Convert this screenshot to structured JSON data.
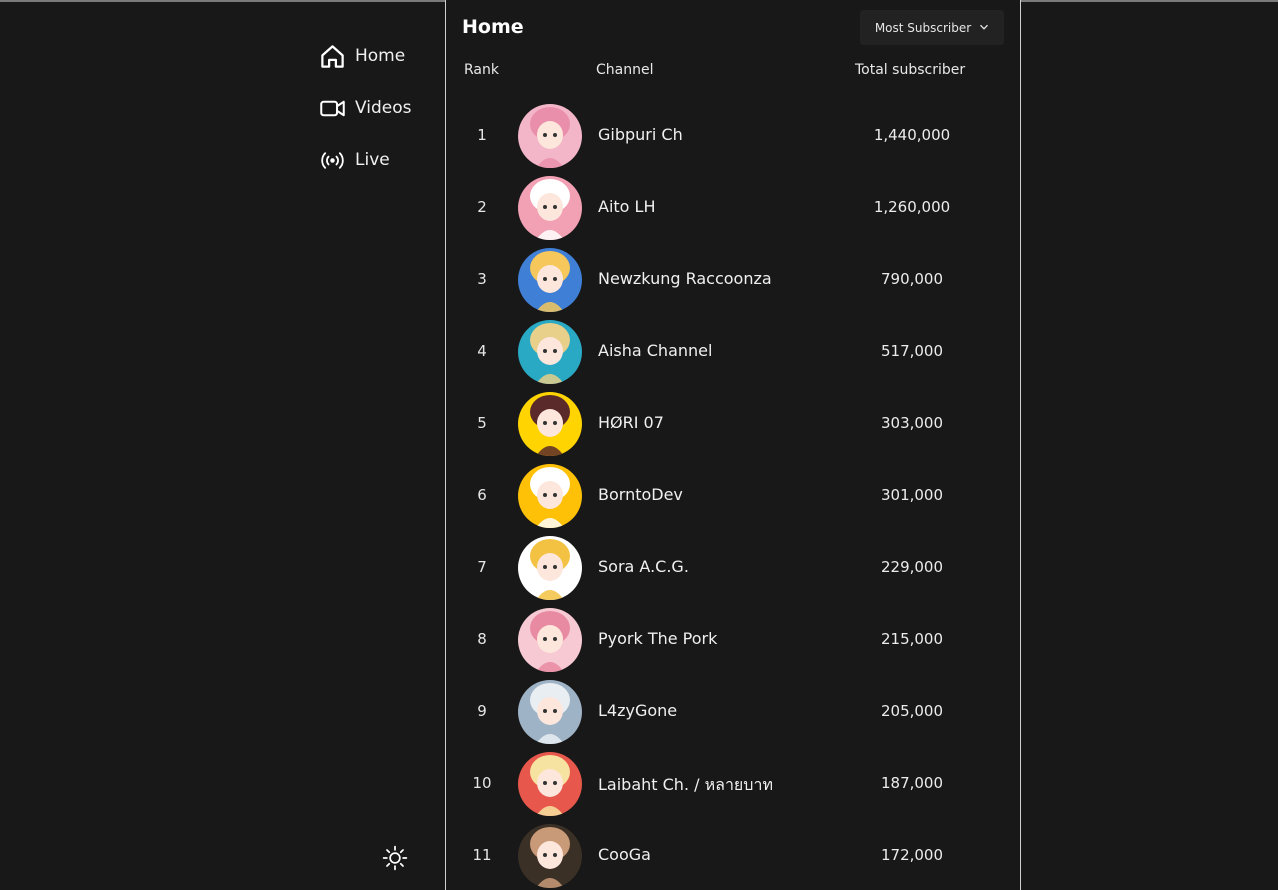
{
  "sidebar": {
    "items": [
      {
        "label": "Home",
        "icon": "home-icon"
      },
      {
        "label": "Videos",
        "icon": "video-icon"
      },
      {
        "label": "Live",
        "icon": "live-icon"
      }
    ],
    "theme_icon": "sun-icon"
  },
  "header": {
    "title": "Home",
    "sort_label": "Most Subscriber",
    "sort_icon": "chevron-down-icon"
  },
  "table": {
    "columns": {
      "rank": "Rank",
      "channel": "Channel",
      "subscribers": "Total subscriber"
    },
    "rows": [
      {
        "rank": "1",
        "name": "Gibpuri Ch",
        "subscribers": "1,440,000",
        "avatar_bg": "#f3b6c9",
        "avatar_fg": "#e98fab"
      },
      {
        "rank": "2",
        "name": "Aito LH",
        "subscribers": "1,260,000",
        "avatar_bg": "#f2a0b3",
        "avatar_fg": "#ffffff"
      },
      {
        "rank": "3",
        "name": "Newzkung Raccoonza",
        "subscribers": "790,000",
        "avatar_bg": "#3f7fd6",
        "avatar_fg": "#f6c75a"
      },
      {
        "rank": "4",
        "name": "Aisha Channel",
        "subscribers": "517,000",
        "avatar_bg": "#2aa9c4",
        "avatar_fg": "#e8cf8a"
      },
      {
        "rank": "5",
        "name": "HØRI 07",
        "subscribers": "303,000",
        "avatar_bg": "#ffd400",
        "avatar_fg": "#5a2a2a"
      },
      {
        "rank": "6",
        "name": "BorntoDev",
        "subscribers": "301,000",
        "avatar_bg": "#ffc107",
        "avatar_fg": "#ffffff"
      },
      {
        "rank": "7",
        "name": "Sora A.C.G.",
        "subscribers": "229,000",
        "avatar_bg": "#ffffff",
        "avatar_fg": "#f4c242"
      },
      {
        "rank": "8",
        "name": "Pyork The Pork",
        "subscribers": "215,000",
        "avatar_bg": "#f6c9d3",
        "avatar_fg": "#e88aa1"
      },
      {
        "rank": "9",
        "name": "L4zyGone",
        "subscribers": "205,000",
        "avatar_bg": "#9fb3c6",
        "avatar_fg": "#e9eef3"
      },
      {
        "rank": "10",
        "name": "Laibaht Ch. / หลายบาท",
        "subscribers": "187,000",
        "avatar_bg": "#e8574b",
        "avatar_fg": "#f7e3a1"
      },
      {
        "rank": "11",
        "name": "CooGa",
        "subscribers": "172,000",
        "avatar_bg": "#3a3026",
        "avatar_fg": "#c99a78"
      }
    ]
  }
}
